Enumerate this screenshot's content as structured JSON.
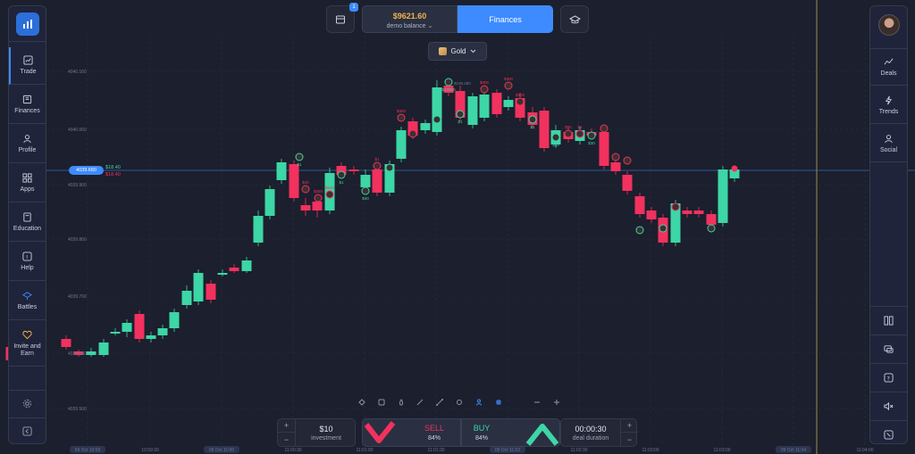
{
  "top_bar": {
    "store_badge": "1",
    "balance_amount": "$9621.60",
    "balance_label": "demo balance ⌄",
    "finances_button": "Finances"
  },
  "asset": {
    "name": "Gold"
  },
  "left_nav": {
    "items": [
      {
        "label": "Trade",
        "icon": "chart-line-icon"
      },
      {
        "label": "Finances",
        "icon": "finances-icon"
      },
      {
        "label": "Profile",
        "icon": "user-icon"
      },
      {
        "label": "Apps",
        "icon": "apps-grid-icon"
      },
      {
        "label": "Education",
        "icon": "book-icon"
      },
      {
        "label": "Help",
        "icon": "help-circle-icon"
      },
      {
        "label": "Battles",
        "icon": "battles-icon"
      },
      {
        "label": "Invite and Earn",
        "icon": "heart-icon"
      }
    ]
  },
  "right_nav": {
    "items": [
      {
        "label": "Deals",
        "icon": "deals-icon"
      },
      {
        "label": "Trends",
        "icon": "lightning-icon"
      },
      {
        "label": "Social",
        "icon": "social-icon"
      }
    ]
  },
  "chart": {
    "current_price": "4039.660",
    "price_up_label": "$18.40",
    "price_down_label": "$18.40",
    "price_levels": [
      "4039.560",
      "4039.660",
      "4039.760",
      "4039.860",
      "4039.960",
      "4040.060",
      "4040.160"
    ],
    "high_marker": "$109.280",
    "trade_labels": [
      "$1",
      "$40",
      "$250",
      "$610",
      "$1",
      "$40",
      "$1",
      "$1",
      "$300",
      "$40",
      "$1",
      "$10000",
      "$1",
      "$300",
      "$300",
      "$400",
      "$1",
      "$40",
      "$50",
      "$1",
      "$30"
    ],
    "time_labels": [
      "09 Oct 10:59",
      "10:59:30",
      "09 Oct 11:00",
      "11:00:30",
      "11:01:00",
      "11:01:30",
      "09 Oct 11:02",
      "11:02:30",
      "11:03:00",
      "11:03:30",
      "11:03:00",
      "09 Oct 11:04",
      "11:04:00"
    ],
    "candle_colors": {
      "up": "#3dd6a6",
      "down": "#f2315f"
    }
  },
  "trade_panel": {
    "investment_value": "$10",
    "investment_label": "investment",
    "sell_label": "SELL",
    "sell_pct": "84%",
    "buy_label": "BUY",
    "buy_pct": "84%",
    "duration_value": "00:00:30",
    "duration_label": "deal duration",
    "plus": "+",
    "minus": "−"
  },
  "colors": {
    "accent": "#3d8bff",
    "up": "#3dd6a6",
    "down": "#f2315f",
    "balance": "#f0b44c"
  }
}
